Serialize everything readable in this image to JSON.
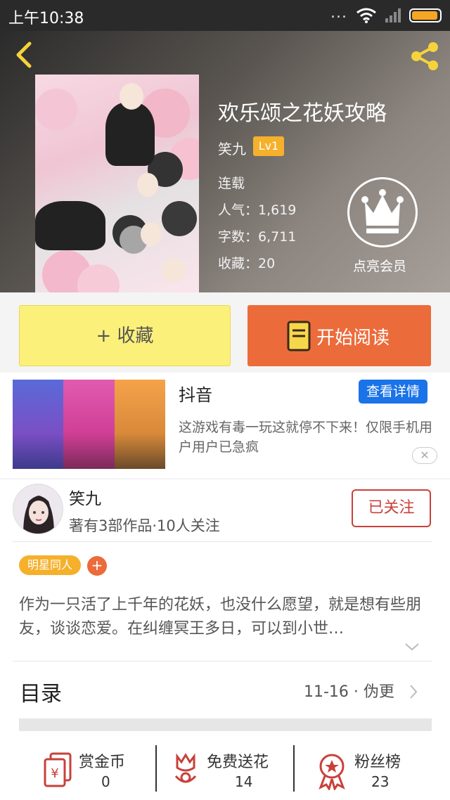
{
  "status_bar": {
    "time": "上午10:38",
    "dots": "..."
  },
  "header": {
    "back": "back",
    "share": "share"
  },
  "book": {
    "title": "欢乐颂之花妖攻略",
    "author": "笑九",
    "level": "Lv1",
    "status": "连载",
    "popularity": "人气：1,619",
    "word_count": "字数：6,711",
    "favorites": "收藏：20",
    "vip_label": "点亮会员"
  },
  "actions": {
    "collect_label": "+ 收藏",
    "read_label": "开始阅读"
  },
  "ad": {
    "title": "抖音",
    "button": "查看详情",
    "description": "这游戏有毒一玩这就停不下来！仅限手机用户用户已急疯",
    "close": "✕"
  },
  "author_card": {
    "name": "笑九",
    "stats": "著有3部作品·10人关注",
    "follow_button": "已关注"
  },
  "tags": [
    "明星同人"
  ],
  "tag_add": "+",
  "synopsis": "作为一只活了上千年的花妖，也没什么愿望，就是想有些朋友，谈谈恋爱。在纠缠冥王多日，可以到小世…",
  "toc": {
    "label": "目录",
    "update": "11-16 · 伪更"
  },
  "bottom_bar": [
    {
      "name": "赏金币",
      "value": "0",
      "icon": "red-envelope-icon"
    },
    {
      "name": "免费送花",
      "value": "14",
      "icon": "flower-icon"
    },
    {
      "name": "粉丝榜",
      "value": "23",
      "icon": "medal-icon"
    }
  ],
  "colors": {
    "accent_orange": "#ec6b3b",
    "collect_yellow": "#fbf07a",
    "level_badge": "#f5b02c",
    "follow_red": "#c9403a",
    "ad_blue": "#1a73e8"
  }
}
